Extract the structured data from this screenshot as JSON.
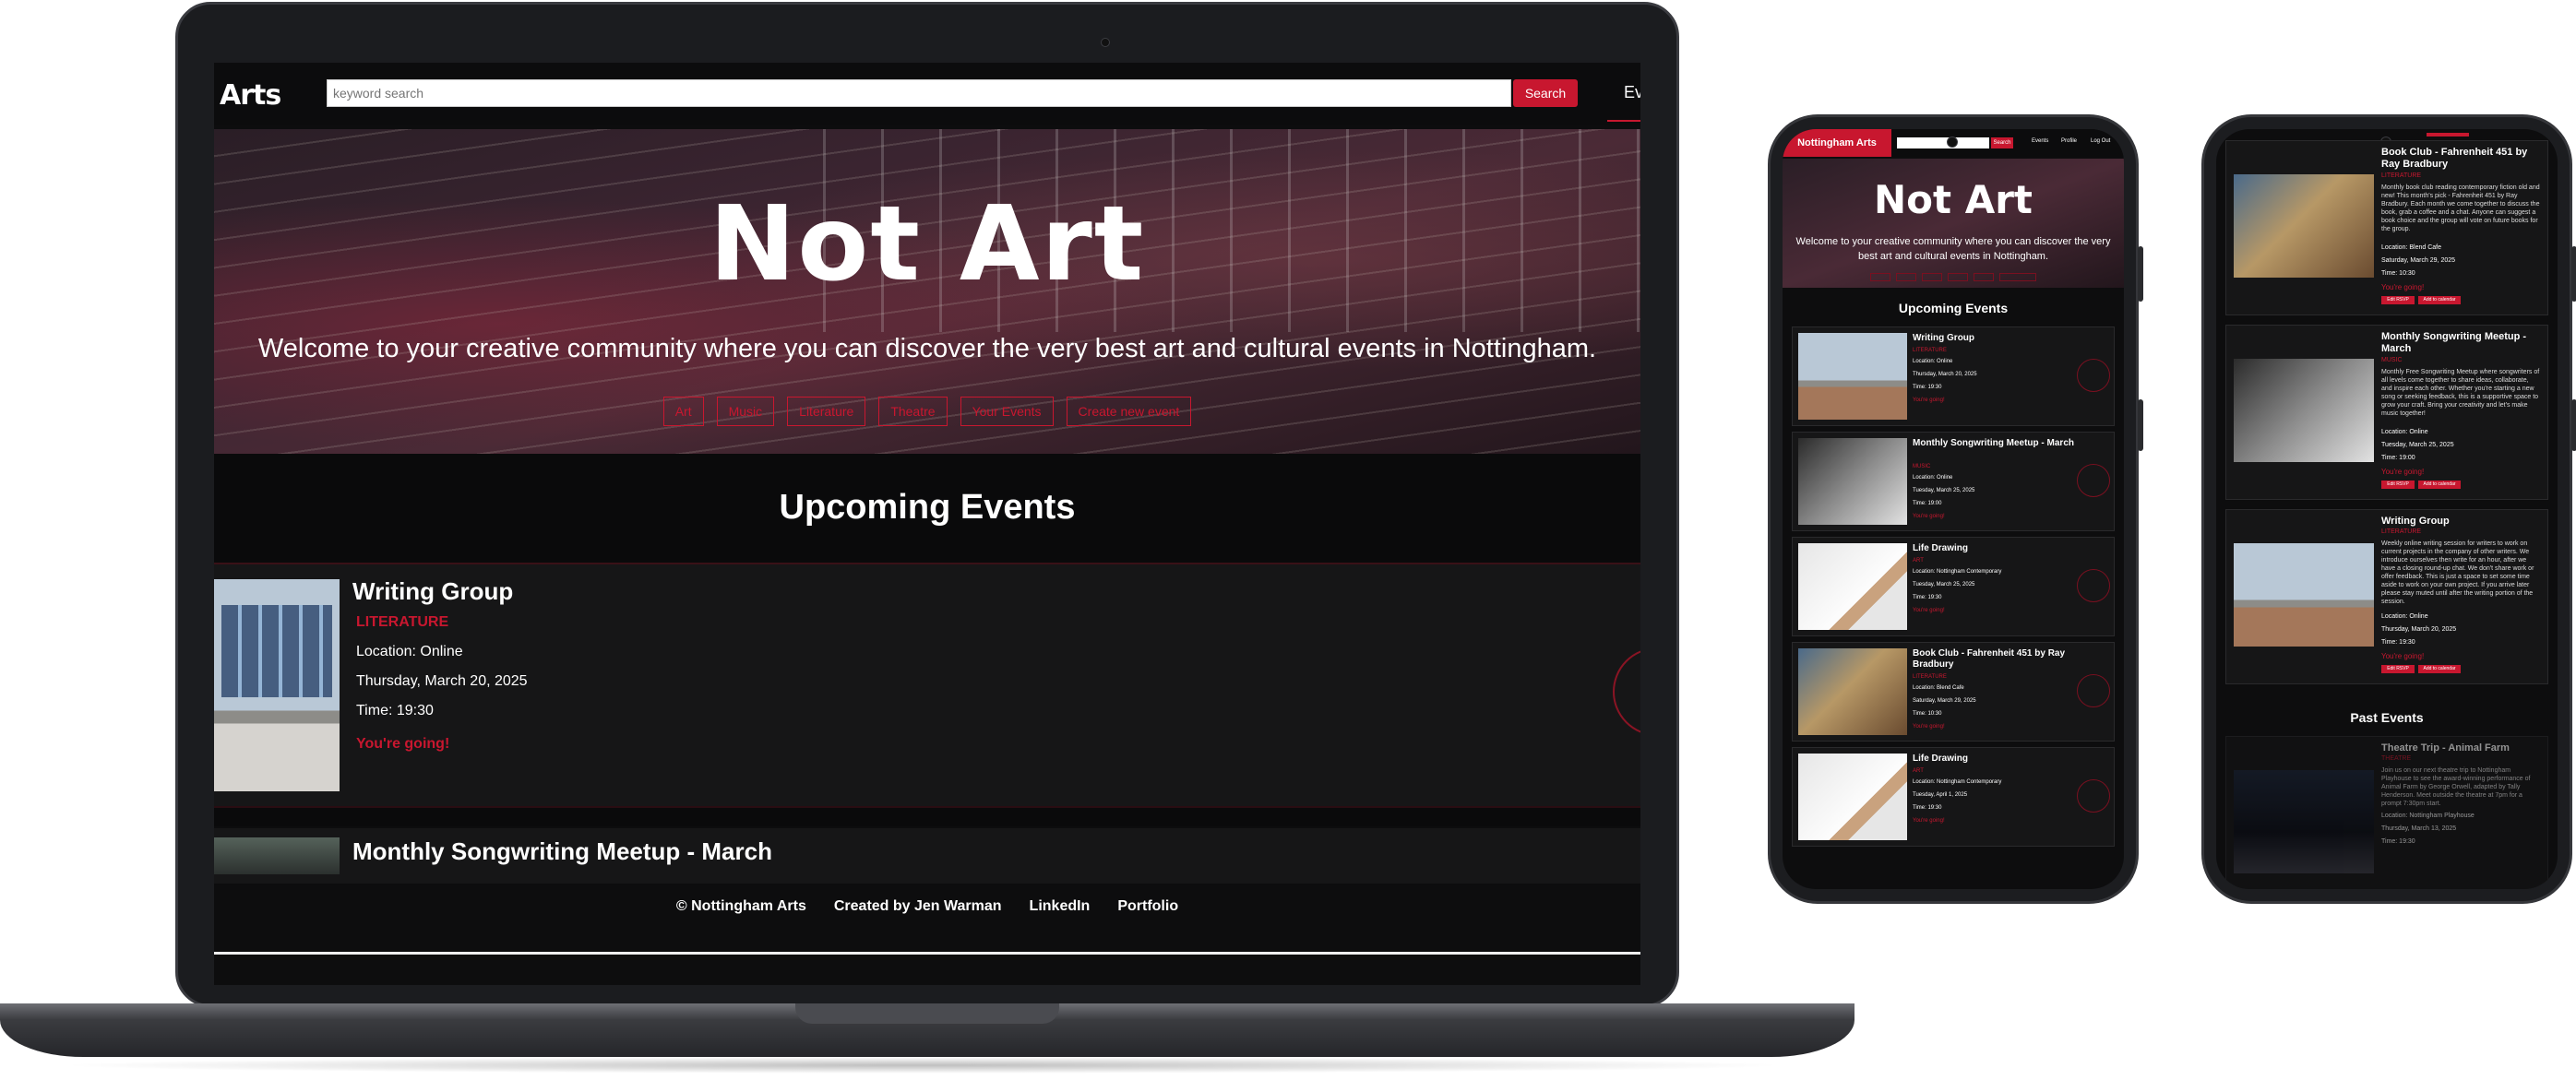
{
  "laptop": {
    "nav": {
      "logo": "Arts",
      "search_placeholder": "keyword search",
      "search_button": "Search",
      "events_link_partial": "Ev"
    },
    "hero": {
      "title": "Not Art",
      "subtitle": "Welcome to your creative community where you can discover the very best art and cultural events in Nottingham.",
      "categories": [
        "Art",
        "Music",
        "Literature",
        "Theatre",
        "Your Events",
        "Create new event"
      ]
    },
    "section_title": "Upcoming Events",
    "events": [
      {
        "title": "Writing Group",
        "category": "LITERATURE",
        "location": "Location: Online",
        "date": "Thursday, March 20, 2025",
        "time": "Time: 19:30",
        "status": "You're going!"
      },
      {
        "title": "Monthly Songwriting Meetup - March"
      }
    ],
    "footer": {
      "copyright": "© Nottingham Arts",
      "credit": "Created by Jen Warman",
      "linkedin": "LinkedIn",
      "portfolio": "Portfolio"
    }
  },
  "phone1": {
    "logo": "Nottingham Arts",
    "search_button": "Search",
    "links": [
      "Events",
      "Profile",
      "Log Out"
    ],
    "hero_title": "Not Art",
    "hero_subtitle": "Welcome to your creative community where you can discover the very best art and cultural events in Nottingham.",
    "section_title": "Upcoming Events",
    "events": [
      {
        "title": "Writing Group",
        "category": "LITERATURE",
        "location": "Location: Online",
        "date": "Thursday, March 20, 2025",
        "time": "Time: 19:30",
        "status": "You're going!"
      },
      {
        "title": "Monthly Songwriting Meetup - March",
        "category": "MUSIC",
        "location": "Location: Online",
        "date": "Tuesday, March 25, 2025",
        "time": "Time: 19:00",
        "status": "You're going!"
      },
      {
        "title": "Life Drawing",
        "category": "ART",
        "location": "Location: Nottingham Contemporary",
        "date": "Tuesday, March 25, 2025",
        "time": "Time: 19:30",
        "status": "You're going!"
      },
      {
        "title": "Book Club - Fahrenheit 451 by Ray Bradbury",
        "category": "LITERATURE",
        "location": "Location: Blend Cafe",
        "date": "Saturday, March 29, 2025",
        "time": "Time: 10:30",
        "status": "You're going!"
      },
      {
        "title": "Life Drawing",
        "category": "ART",
        "location": "Location: Nottingham Contemporary",
        "date": "Tuesday, April 1, 2025",
        "time": "Time: 19:30",
        "status": "You're going!"
      }
    ]
  },
  "phone2": {
    "events": [
      {
        "title": "Book Club - Fahrenheit 451 by Ray Bradbury",
        "category": "LITERATURE",
        "description": "Monthly book club reading contemporary fiction old and new! This month's pick - Fahrenheit 451 by Ray Bradbury. Each month we come together to discuss the book, grab a coffee and a chat. Anyone can suggest a book choice and the group will vote on future books for the group.",
        "location": "Location: Blend Cafe",
        "date": "Saturday, March 29, 2025",
        "time": "Time: 10:30",
        "status": "You're going!",
        "buttons": [
          "Edit RSVP",
          "Add to calendar"
        ]
      },
      {
        "title": "Monthly Songwriting Meetup - March",
        "category": "MUSIC",
        "description": "Monthly Free Songwriting Meetup where songwriters of all levels come together to share ideas, collaborate, and inspire each other. Whether you're starting a new song or seeking feedback, this is a supportive space to grow your craft. Bring your creativity and let's make music together!",
        "location": "Location: Online",
        "date": "Tuesday, March 25, 2025",
        "time": "Time: 19:00",
        "status": "You're going!",
        "buttons": [
          "Edit RSVP",
          "Add to calendar"
        ]
      },
      {
        "title": "Writing Group",
        "category": "LITERATURE",
        "description": "Weekly online writing session for writers to work on current projects in the company of other writers. We introduce ourselves then write for an hour, after we have a closing round-up chat. We don't share work or offer feedback. This is just a space to set some time aside to work on your own project. If you arrive later please stay muted until after the writing portion of the session.",
        "location": "Location: Online",
        "date": "Thursday, March 20, 2025",
        "time": "Time: 19:30",
        "status": "You're going!",
        "buttons": [
          "Edit RSVP",
          "Add to calendar"
        ]
      }
    ],
    "past_title": "Past Events",
    "past_event": {
      "title": "Theatre Trip - Animal Farm",
      "category": "THEATRE",
      "description": "Join us on our next theatre trip to Nottingham Playhouse to see the award-winning performance of Animal Farm by George Orwell, adapted by Tally Henderson. Meet outside the theatre at 7pm for a prompt 7:30pm start.",
      "location": "Location: Nottingham Playhouse",
      "date": "Thursday, March 13, 2025",
      "time": "Time: 19:30"
    }
  }
}
